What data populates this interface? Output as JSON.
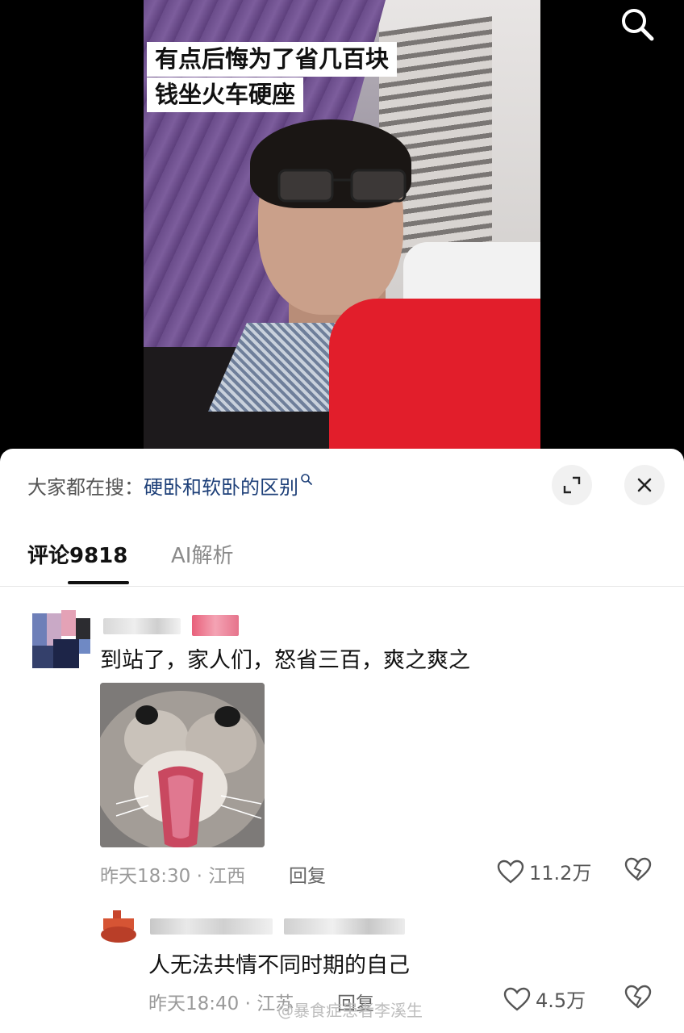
{
  "video": {
    "caption_line1": "有点后悔为了省几百块",
    "caption_line2": "钱坐火车硬座"
  },
  "search_suggest": {
    "prefix": "大家都在搜：",
    "query": "硬卧和软卧的区别",
    "icon": "search-icon"
  },
  "tabs": [
    {
      "label": "评论9818",
      "active": true
    },
    {
      "label": "AI解析",
      "active": false
    }
  ],
  "comments": [
    {
      "text": "到站了，家人们，怒省三百，爽之爽之",
      "time": "昨天18:30",
      "location": "江西",
      "reply_label": "回复",
      "likes": "11.2万",
      "has_image": true
    }
  ],
  "replies": [
    {
      "text": "人无法共情不同时期的自己",
      "time": "昨天18:40",
      "location": "江苏",
      "reply_label": "回复",
      "likes": "4.5万"
    }
  ],
  "separator": "·",
  "watermark": "@暴食症患者李溪生",
  "colors": {
    "link": "#1d3f78",
    "sheet_bg": "#ffffff",
    "muted": "#9a9a9a"
  }
}
